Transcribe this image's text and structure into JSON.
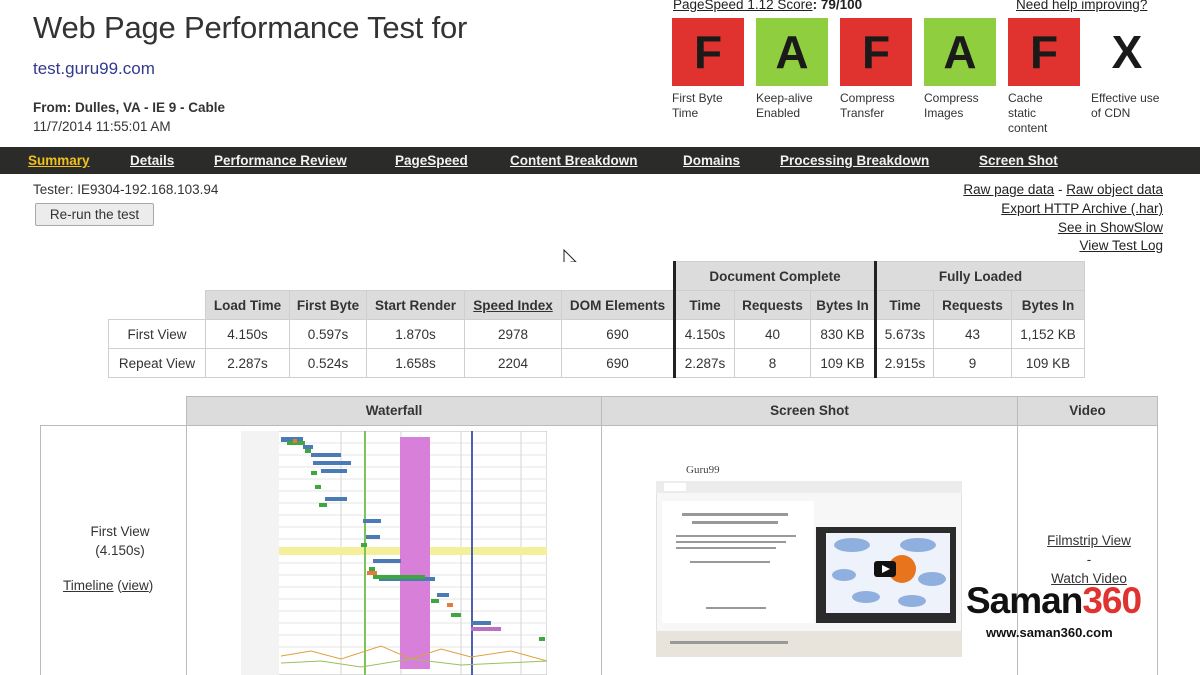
{
  "header": {
    "title": "Web Page Performance Test for",
    "url": "test.guru99.com",
    "from_label": "From:",
    "from_value": "Dulles, VA - IE 9 - Cable",
    "datetime": "11/7/2014 11:55:01 AM"
  },
  "pagespeed": {
    "label": "PageSpeed 1.12 Score",
    "score": ": 79/100",
    "help_link": "Need help improving?"
  },
  "grades": [
    {
      "letter": "F",
      "status": "fail",
      "caption": "First Byte Time"
    },
    {
      "letter": "A",
      "status": "pass",
      "caption": "Keep-alive Enabled"
    },
    {
      "letter": "F",
      "status": "fail",
      "caption": "Compress Transfer"
    },
    {
      "letter": "A",
      "status": "pass",
      "caption": "Compress Images"
    },
    {
      "letter": "F",
      "status": "fail",
      "caption": "Cache static content"
    },
    {
      "letter": "X",
      "status": "na",
      "caption": "Effective use of CDN"
    }
  ],
  "nav": {
    "items": [
      "Summary",
      "Details",
      "Performance Review",
      "PageSpeed",
      "Content Breakdown",
      "Domains",
      "Processing Breakdown",
      "Screen Shot"
    ],
    "active": "Summary"
  },
  "tester": "Tester: IE9304-192.168.103.94",
  "rerun_label": "Re-run the test",
  "right_links": [
    "Raw page data",
    "Raw object data",
    "Export HTTP Archive (.har)",
    "See in ShowSlow",
    "View Test Log"
  ],
  "results": {
    "group_headers": [
      "Document Complete",
      "Fully Loaded"
    ],
    "columns": [
      "Load Time",
      "First Byte",
      "Start Render",
      "Speed Index",
      "DOM Elements",
      "Time",
      "Requests",
      "Bytes In",
      "Time",
      "Requests",
      "Bytes In"
    ],
    "rows": [
      {
        "label": "First View",
        "values": [
          "4.150s",
          "0.597s",
          "1.870s",
          "2978",
          "690",
          "4.150s",
          "40",
          "830 KB",
          "5.673s",
          "43",
          "1,152 KB"
        ]
      },
      {
        "label": "Repeat View",
        "values": [
          "2.287s",
          "0.524s",
          "1.658s",
          "2204",
          "690",
          "2.287s",
          "8",
          "109 KB",
          "2.915s",
          "9",
          "109 KB"
        ]
      }
    ]
  },
  "bottom": {
    "headers": [
      "Waterfall",
      "Screen Shot",
      "Video"
    ],
    "first_view": "First View",
    "first_view_time": "(4.150s)",
    "timeline": "Timeline",
    "view": "view",
    "filmstrip": "Filmstrip View",
    "dash": "-",
    "watch_video": "Watch Video"
  },
  "watermark": {
    "brand_a": "Saman",
    "brand_b": "360",
    "url": "www.saman360.com"
  },
  "colors": {
    "fail": "#e0322e",
    "pass": "#8fce3e",
    "nav_bg": "#2b2b29",
    "nav_active": "#f0c020"
  }
}
